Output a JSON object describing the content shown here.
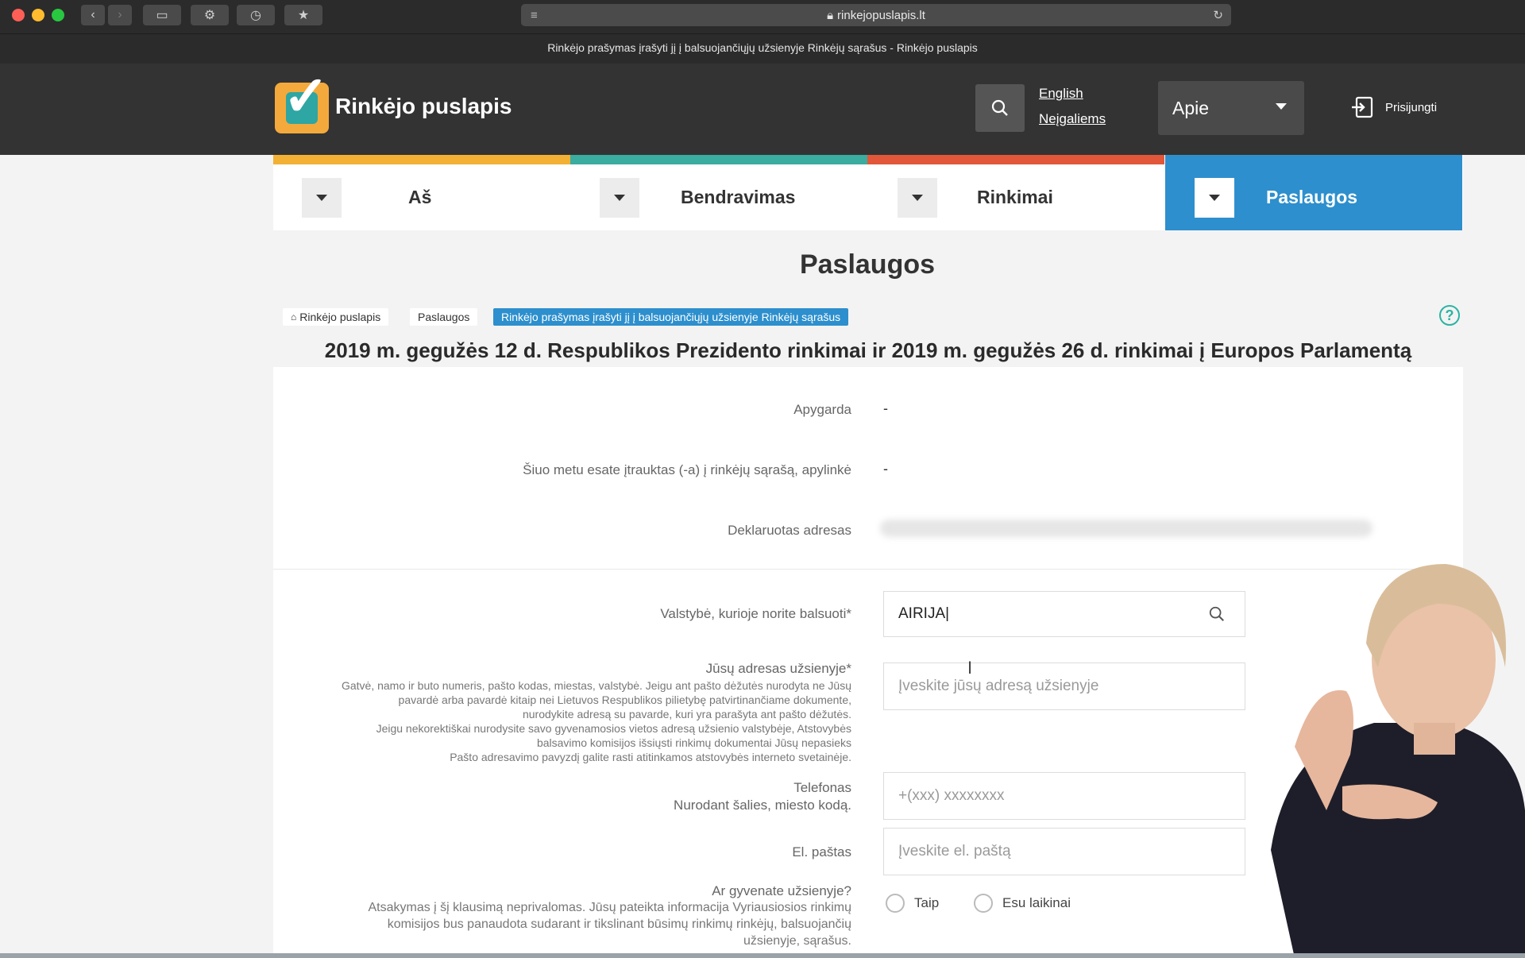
{
  "browser": {
    "address": "rinkejopuslapis.lt",
    "tab_title": "Rinkėjo prašymas įrašyti jį į balsuojančiųjų užsienyje Rinkėjų sąrašus - Rinkėjo puslapis"
  },
  "header": {
    "brand": "Rinkėjo puslapis",
    "lang_english": "English",
    "lang_disabled": "Neįgaliems",
    "apie": "Apie",
    "login": "Prisijungti"
  },
  "nav": {
    "items": [
      {
        "label": "Aš",
        "color": "#f2b134"
      },
      {
        "label": "Bendravimas",
        "color": "#3aaca0"
      },
      {
        "label": "Rinkimai",
        "color": "#e2573a"
      },
      {
        "label": "Paslaugos",
        "color": "#2d8fcd"
      }
    ]
  },
  "page": {
    "title": "Paslaugos",
    "breadcrumb": [
      "Rinkėjo puslapis",
      "Paslaugos",
      "Rinkėjo prašymas įrašyti jį į balsuojančiųjų užsienyje Rinkėjų sąrašus"
    ],
    "election": "2019 m. gegužės 12 d. Respublikos Prezidento rinkimai ir 2019 m. gegužės 26 d. rinkimai į Europos Parlamentą"
  },
  "form": {
    "apygarda_label": "Apygarda",
    "apygarda_value": "-",
    "current_label": "Šiuo metu esate įtrauktas (-a) į rinkėjų sąrašą, apylinkė",
    "current_value": "-",
    "address_label": "Deklaruotas adresas",
    "country_label": "Valstybė, kurioje norite balsuoti*",
    "country_value": "AIRIJA",
    "abroad_label": "Jūsų adresas užsienyje*",
    "abroad_note": [
      "Gatvė, namo ir buto numeris, pašto kodas, miestas, valstybė. Jeigu ant pašto dėžutės nurodyta ne Jūsų",
      "pavardė arba pavardė kitaip nei Lietuvos Respublikos pilietybę patvirtinančiame dokumente,",
      "nurodykite adresą su pavarde, kuri yra parašyta ant pašto dėžutės.",
      "Jeigu nekorektiškai nurodysite savo gyvenamosios vietos adresą užsienio valstybėje, Atstovybės",
      "balsavimo komisijos išsiųsti rinkimų dokumentai Jūsų nepasieks",
      "Pašto adresavimo pavyzdį galite rasti atitinkamos atstovybės interneto svetainėje."
    ],
    "abroad_placeholder": "Įveskite jūsų adresą užsienyje",
    "phone_label": "Telefonas",
    "phone_note": "Nurodant šalies, miesto kodą.",
    "phone_placeholder": "+(xxx) xxxxxxxx",
    "email_label": "El. paštas",
    "email_placeholder": "Įveskite el. paštą",
    "live_label": "Ar gyvenate užsienyje?",
    "live_note": [
      "Atsakymas į šį klausimą neprivalomas. Jūsų pateikta informacija Vyriausiosios rinkimų",
      "komisijos bus panaudota sudarant ir tikslinant būsimų rinkimų rinkėjų, balsuojančių",
      "užsienyje, sąrašus."
    ],
    "radio_yes": "Taip",
    "radio_temp": "Esu laikinai"
  }
}
